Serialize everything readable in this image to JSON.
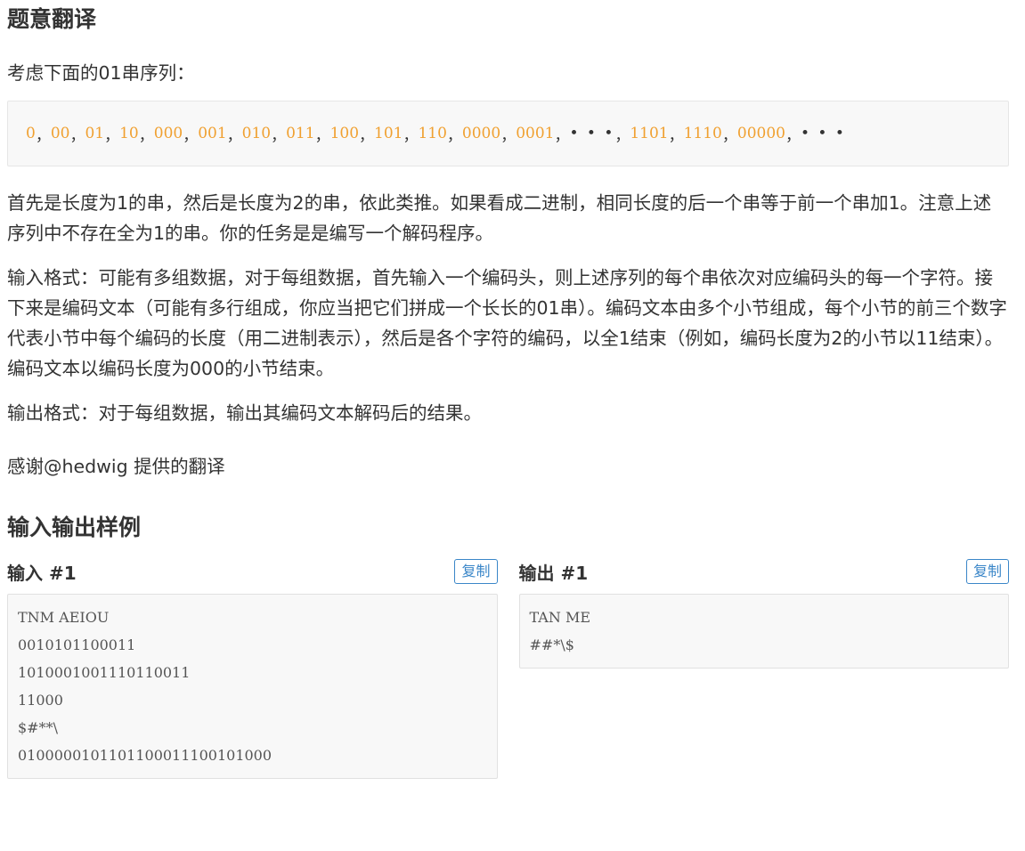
{
  "translation": {
    "title": "题意翻译",
    "intro": "考虑下面的01串序列：",
    "sequence": [
      "0",
      "00",
      "01",
      "10",
      "000",
      "001",
      "010",
      "011",
      "100",
      "101",
      "110",
      "0000",
      "0001",
      "• • •",
      "1101",
      "1110",
      "00000",
      "• • •"
    ],
    "paragraph1": "首先是长度为1的串，然后是长度为2的串，依此类推。如果看成二进制，相同长度的后一个串等于前一个串加1。注意上述序列中不存在全为1的串。你的任务是是编写一个解码程序。",
    "paragraph2": "输入格式：可能有多组数据，对于每组数据，首先输入一个编码头，则上述序列的每个串依次对应编码头的每一个字符。接下来是编码文本（可能有多行组成，你应当把它们拼成一个长长的01串）。编码文本由多个小节组成，每个小节的前三个数字代表小节中每个编码的长度（用二进制表示），然后是各个字符的编码，以全1结束（例如，编码长度为2的小节以11结束）。编码文本以编码长度为000的小节结束。",
    "paragraph3": "输出格式：对于每组数据，输出其编码文本解码后的结果。",
    "credit": "感谢@hedwig 提供的翻译"
  },
  "samples": {
    "title": "输入输出样例",
    "input": {
      "title": "输入 #1",
      "copy_label": "复制",
      "lines": [
        "TNM AEIOU",
        "0010101100011",
        "1010001001110110011",
        "11000",
        "$#**\\",
        "0100000101101100011100101000"
      ]
    },
    "output": {
      "title": "输出 #1",
      "copy_label": "复制",
      "lines": [
        "TAN ME",
        "##*\\$"
      ]
    }
  },
  "colors": {
    "sequence_number": "#f0a030",
    "copy_button": "#3a86c8"
  }
}
